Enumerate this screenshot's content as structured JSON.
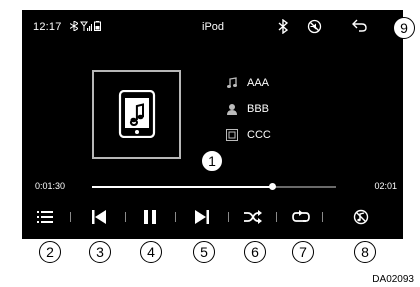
{
  "status_bar": {
    "time": "12:17",
    "title": "iPod"
  },
  "now_playing": {
    "title": "AAA",
    "artist": "BBB",
    "album": "CCC"
  },
  "progress": {
    "elapsed": "0:01:30",
    "total": "02:01",
    "fraction": 0.74
  },
  "controls": [
    "menu-icon",
    "previous-track-icon",
    "pause-icon",
    "next-track-icon",
    "shuffle-icon",
    "repeat-icon",
    "sound-off-icon"
  ],
  "callouts": [
    "1",
    "2",
    "3",
    "4",
    "5",
    "6",
    "7",
    "8",
    "9"
  ],
  "caption": "DA02093"
}
